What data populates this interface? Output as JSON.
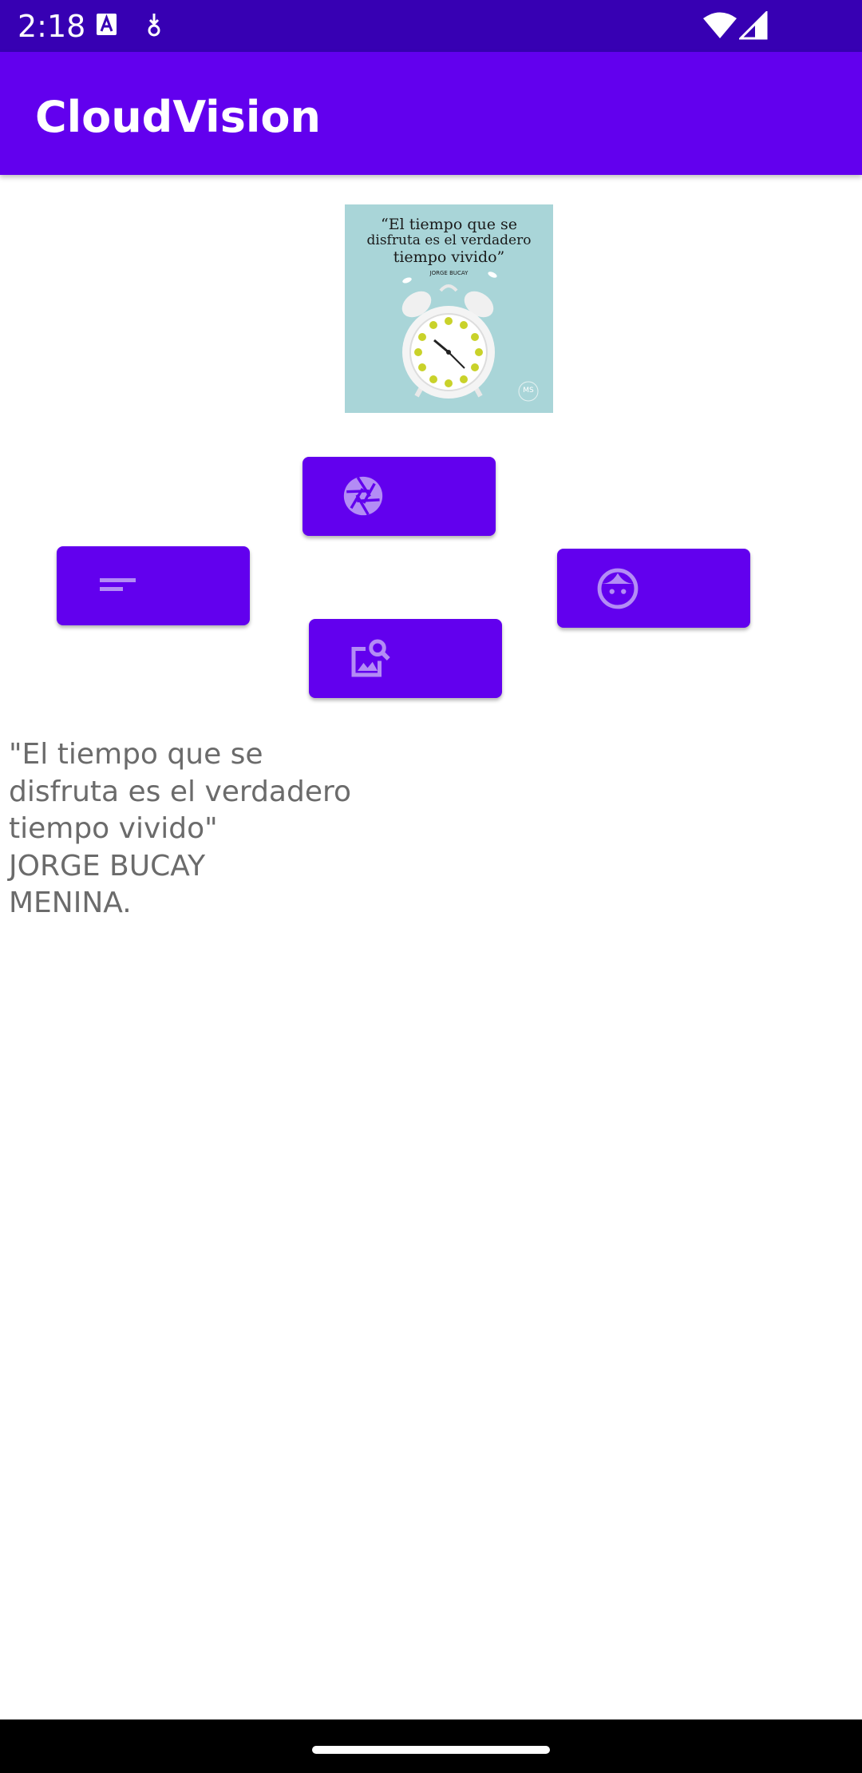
{
  "status_bar": {
    "time": "2:18",
    "icons": [
      "text-a-icon",
      "download-icon",
      "wifi-icon",
      "signal-icon"
    ]
  },
  "app_bar": {
    "title": "CloudVision"
  },
  "image": {
    "quote_lines": [
      "“El tiempo que se",
      "disfruta es el verdadero",
      "tiempo vivido”"
    ],
    "author": "JORGE BUCAY",
    "watermark": "MS"
  },
  "buttons": [
    {
      "name": "camera-button",
      "icon": "camera-aperture-icon"
    },
    {
      "name": "text-detection-button",
      "icon": "short-text-icon"
    },
    {
      "name": "face-detection-button",
      "icon": "face-icon"
    },
    {
      "name": "image-search-button",
      "icon": "image-search-icon"
    }
  ],
  "result": {
    "text": "\"El tiempo que se\ndisfruta es el verdadero\ntiempo vivido\"\nJORGE BUCAY\nMENINA."
  },
  "colors": {
    "status_bar": "#3700b3",
    "primary": "#6200ee",
    "icon_tint": "#b38cf5",
    "result_text": "#6b6b6b"
  }
}
